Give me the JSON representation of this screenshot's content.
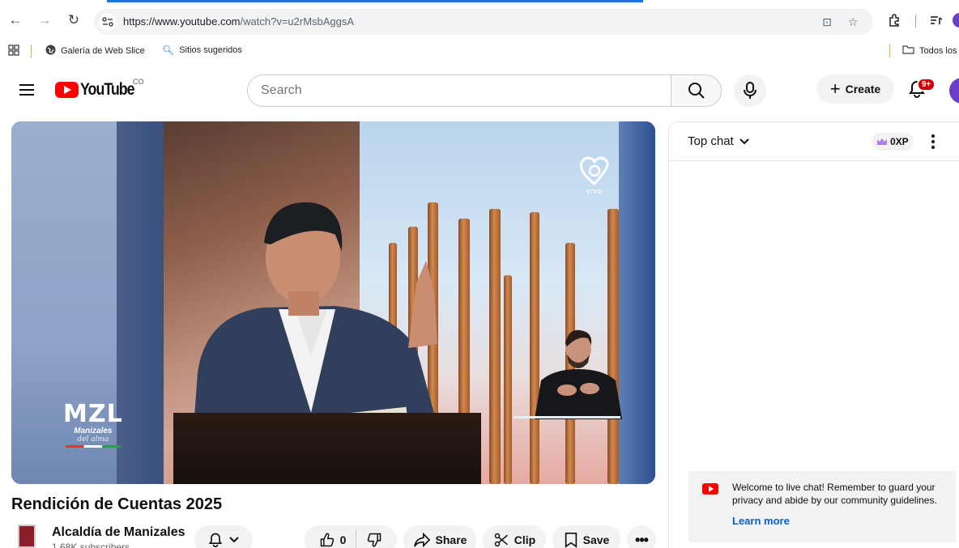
{
  "browser": {
    "url_host": "https://www.youtube.com",
    "url_path": "/watch?v=u2rMsbAggsA",
    "bookmarks": [
      {
        "label": "Galería de Web Slice"
      },
      {
        "label": "Sitios sugeridos"
      }
    ],
    "all_bookmarks_label": "Todos los"
  },
  "header": {
    "logo_text": "YouTube",
    "country_code": "CO",
    "search_placeholder": "Search",
    "create_label": "Create",
    "notification_badge": "9+"
  },
  "video": {
    "title": "Rendición de Cuentas 2025",
    "overlay_logo": "MZL",
    "overlay_city": "Manizales",
    "overlay_tagline": "del alma",
    "overlay_channel_mark": "VIVO"
  },
  "channel": {
    "name": "Alcaldía de Manizales",
    "subscribers": "1.68K subscribers"
  },
  "actions": {
    "likes": "0",
    "share_label": "Share",
    "clip_label": "Clip",
    "save_label": "Save"
  },
  "chat": {
    "mode_label": "Top chat",
    "xp_label": "0XP",
    "welcome_text": "Welcome to live chat! Remember to guard your privacy and abide by our community guidelines.",
    "learn_more_label": "Learn more"
  },
  "colors": {
    "brand_red": "#ff0000",
    "link_blue": "#065fd4",
    "browser_accent": "#1a73e8"
  }
}
